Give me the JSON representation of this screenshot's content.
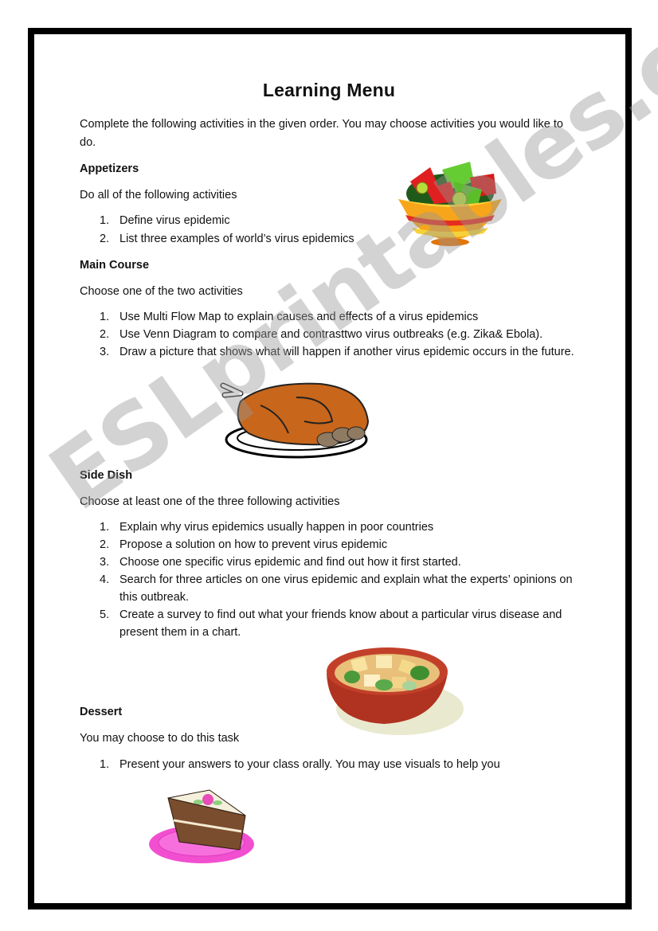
{
  "document": {
    "title": "Learning Menu",
    "intro": "Complete the following activities in the given order. You may choose activities you would like to do.",
    "sections": [
      {
        "heading": "Appetizers",
        "instruction": "Do all of the following activities",
        "items": [
          "Define virus epidemic",
          "List three examples of world’s virus epidemics"
        ],
        "image": "salad-bowl-icon"
      },
      {
        "heading": "Main Course",
        "instruction": "Choose one of the two activities",
        "items": [
          "Use Multi Flow Map to explain causes and effects of a virus epidemics",
          "Use Venn Diagram to compare and contrasttwo virus outbreaks (e.g. Zika& Ebola).",
          "Draw a picture that shows what will happen if another virus epidemic occurs in the future."
        ],
        "image": "roast-turkey-icon"
      },
      {
        "heading": "Side Dish",
        "instruction": "Choose at least one of the three following activities",
        "items": [
          "Explain why virus epidemics usually happen in poor countries",
          "Propose a solution on how to prevent virus epidemic",
          "Choose one specific virus epidemic and find out how it first started.",
          "Search for three articles on one virus epidemic and explain what the experts’ opinions on this outbreak.",
          "Create a survey to find out what your friends know about a particular virus disease and present them in a chart."
        ],
        "image": "potato-salad-bowl-icon"
      },
      {
        "heading": "Dessert",
        "instruction": "You may choose to do this task",
        "items": [
          "Present your answers to your class orally. You may use visuals to help you"
        ],
        "image": "cake-slice-icon"
      }
    ],
    "numbers": [
      "1.",
      "2.",
      "3.",
      "4.",
      "5."
    ]
  },
  "watermark": "ESLprintables.com"
}
